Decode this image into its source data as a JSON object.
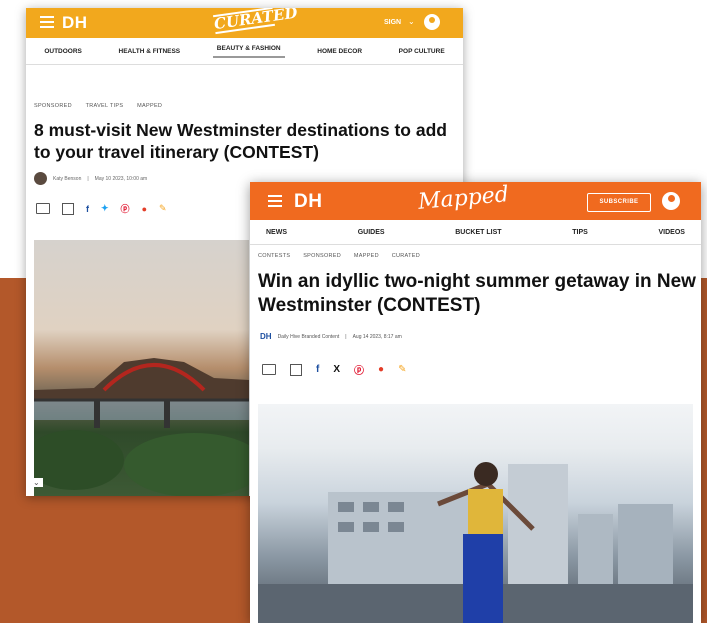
{
  "card1": {
    "brand": "DH",
    "logo_text": "CURATED",
    "signin": "SIGN",
    "nav": [
      "OUTDOORS",
      "HEALTH & FITNESS",
      "BEAUTY & FASHION",
      "HOME DECOR",
      "POP CULTURE"
    ],
    "tags": [
      "SPONSORED",
      "TRAVEL TIPS",
      "MAPPED"
    ],
    "title": "8 must-visit New Westminster destinations to add to your travel itinerary (CONTEST)",
    "byline_author": "Katy Benson",
    "byline_date": "May 10 2023, 10:00 am"
  },
  "card2": {
    "brand": "DH",
    "logo_text": "Mapped",
    "subscribe": "SUBSCRIBE",
    "nav": [
      "NEWS",
      "GUIDES",
      "BUCKET LIST",
      "TIPS",
      "VIDEOS"
    ],
    "tags": [
      "CONTESTS",
      "SPONSORED",
      "MAPPED",
      "CURATED"
    ],
    "title": "Win an idyllic two-night summer getaway in New Westminster (CONTEST)",
    "byline_logo": "DH",
    "byline_author": "Daily Hive Branded Content",
    "byline_date": "Aug 14 2023, 8:17 am"
  },
  "colors": {
    "curated_header": "#f2a81d",
    "mapped_header": "#f06a1f",
    "background_band": "#b3582a"
  },
  "icons": [
    "menu-icon",
    "user-icon",
    "chevron-down-icon",
    "print-icon",
    "bookmark-icon",
    "facebook-icon",
    "twitter-icon",
    "x-icon",
    "pinterest-icon",
    "reddit-icon",
    "pencil-icon"
  ]
}
